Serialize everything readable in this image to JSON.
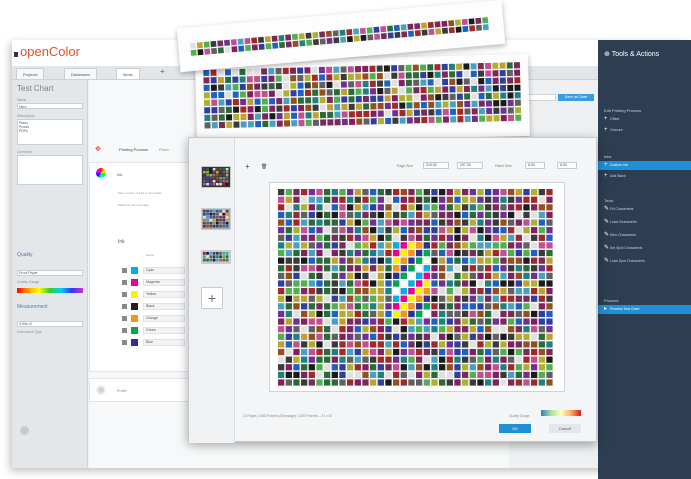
{
  "app": {
    "logo": "openColor",
    "win_controls": "— ☐"
  },
  "tabs": [
    {
      "label": "Projects"
    },
    {
      "label": "Databases"
    },
    {
      "label": "Items"
    }
  ],
  "left_panel": {
    "title": "Test Chart",
    "name_label": "Name",
    "name_value": "Hero",
    "description_label": "Description",
    "description_value": "Plans\nProofs\nPDFs",
    "comment_label": "Comment",
    "quality_section": "Quality",
    "quality_select": "Proof Paper",
    "gradient_label": "Quality Gauge",
    "measurement_section": "Measurement",
    "measurement_select": "i1iSis v2",
    "measurement_label": "Instrument Type"
  },
  "center": {
    "header_title": "Printing Process",
    "header_sub": "Flexo",
    "card_title": "Ink",
    "desc_line1": "Max number of inks in composite",
    "desc_line2": "Maximum ink coverage",
    "inks_title": "Ink",
    "inks_header": "Name",
    "inks": [
      {
        "name": "Cyan",
        "color": "#00aeef"
      },
      {
        "name": "Magenta",
        "color": "#ec008c"
      },
      {
        "name": "Yellow",
        "color": "#fff200"
      },
      {
        "name": "Black",
        "color": "#231f20"
      },
      {
        "name": "Orange",
        "color": "#f7941d"
      },
      {
        "name": "Green",
        "color": "#00a651"
      },
      {
        "name": "Blue",
        "color": "#2e3192"
      }
    ],
    "profile_label": "Profile"
  },
  "right_panel": {
    "title": "Tools & Actions",
    "groups": [
      {
        "label": "Edit Printing Process",
        "items": [
          {
            "label": "Offset"
          },
          {
            "label": "Gravure"
          }
        ]
      },
      {
        "label": "Inks",
        "items": [
          {
            "label": "Custom Ink",
            "active": true
          },
          {
            "label": "Add Black"
          }
        ]
      },
      {
        "label": "Tools",
        "items": [
          {
            "label": "Fill Characteris"
          },
          {
            "label": "Load Characteris"
          },
          {
            "label": "New Characteris"
          },
          {
            "label": "Set Spot Characteris"
          },
          {
            "label": "Load Spot Characteris"
          }
        ]
      },
      {
        "label": "Process",
        "items": [
          {
            "label": "Process Test Chart",
            "active": true
          }
        ]
      }
    ],
    "top_button": "Save as Chart"
  },
  "dialog": {
    "page_size_label": "Page Size",
    "page_w": "210,00",
    "page_h": "297,00",
    "patch_size_label": "Patch Size",
    "patch_w": "6,00",
    "patch_h": "6,00",
    "status": "24 Pages | 2048 Patches (Shrinkage) | 1260 Patches – 31 x 30",
    "scale_label": "Quality Gauge",
    "ok": "OK",
    "cancel": "Cancel"
  },
  "colors": {
    "accent": "#1f8fd6",
    "sidebar_dark": "#2d3e52",
    "logo": "#e84c2b"
  }
}
